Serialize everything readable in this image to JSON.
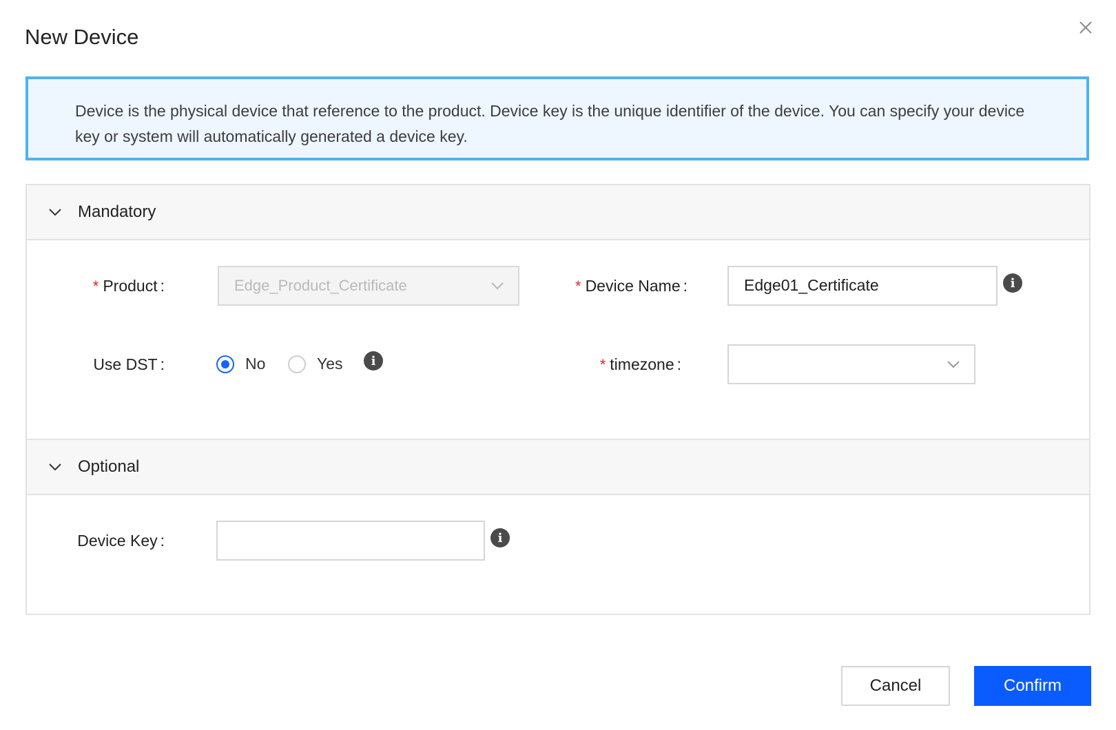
{
  "dialog": {
    "title": "New Device",
    "close_icon": "close-icon"
  },
  "alert": {
    "text": "Device is the physical device that reference to the product. Device key is the unique identifier of the device. You can specify your device key or system will automatically generated a device key."
  },
  "sections": {
    "mandatory": {
      "label": "Mandatory",
      "expanded": true,
      "fields": {
        "product": {
          "label": "Product",
          "required": true,
          "value": "Edge_Product_Certificate",
          "disabled": true
        },
        "device_name": {
          "label": "Device Name",
          "required": true,
          "value": "Edge01_Certificate"
        },
        "use_dst": {
          "label": "Use DST",
          "required": false,
          "options": [
            "No",
            "Yes"
          ],
          "selected": "No"
        },
        "timezone": {
          "label": "timezone",
          "required": true,
          "value": ""
        }
      }
    },
    "optional": {
      "label": "Optional",
      "expanded": true,
      "fields": {
        "device_key": {
          "label": "Device Key",
          "required": false,
          "value": ""
        }
      }
    }
  },
  "required_marker": "*",
  "colon": ":",
  "info_glyph": "i",
  "buttons": {
    "cancel": "Cancel",
    "confirm": "Confirm"
  },
  "colors": {
    "primary": "#0b5cff",
    "alert_border": "#4db3f0",
    "alert_bg": "#eef6ff",
    "required": "#e8202a"
  }
}
